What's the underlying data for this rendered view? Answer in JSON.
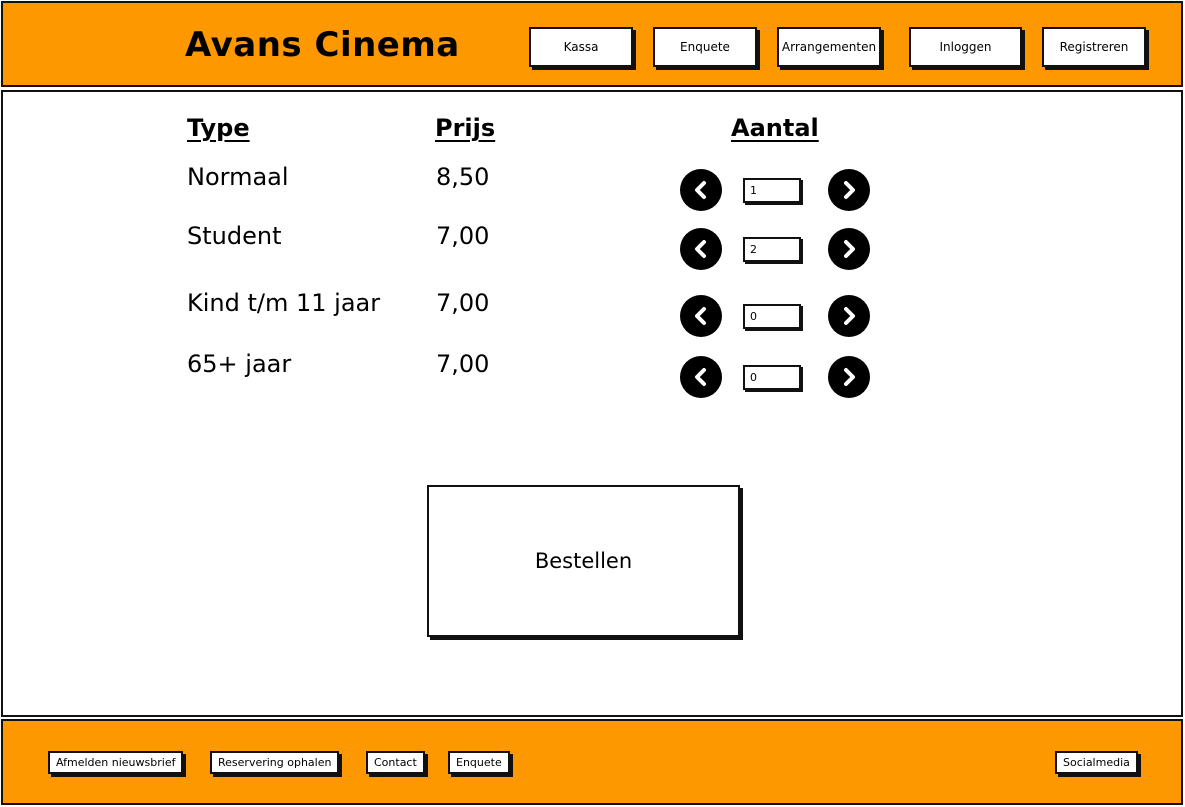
{
  "header": {
    "title": "Avans Cinema",
    "nav": [
      "Kassa",
      "Enquete",
      "Arrangementen",
      "Inloggen",
      "Registreren"
    ]
  },
  "table": {
    "headers": {
      "type": "Type",
      "price": "Prijs",
      "quantity": "Aantal"
    },
    "rows": [
      {
        "type": "Normaal",
        "price": "8,50",
        "quantity": "1"
      },
      {
        "type": "Student",
        "price": "7,00",
        "quantity": "2"
      },
      {
        "type": "Kind t/m 11 jaar",
        "price": "7,00",
        "quantity": "0"
      },
      {
        "type": "65+ jaar",
        "price": "7,00",
        "quantity": "0"
      }
    ]
  },
  "order_button": "Bestellen",
  "footer": {
    "links": [
      "Afmelden nieuwsbrief",
      "Reservering ophalen",
      "Contact",
      "Enquete"
    ],
    "social": "Socialmedia"
  },
  "colors": {
    "accent": "#fe9800",
    "border": "#111111"
  },
  "icons": {
    "decrease": "chevron-left-circle-icon",
    "increase": "chevron-right-circle-icon"
  }
}
